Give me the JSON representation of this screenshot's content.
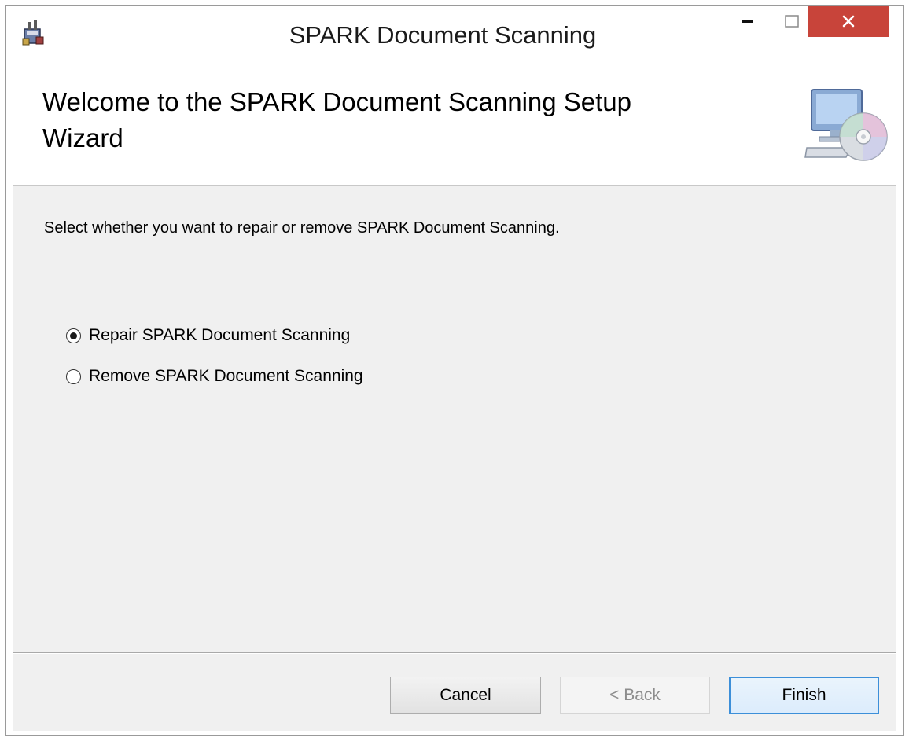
{
  "window": {
    "title": "SPARK Document Scanning"
  },
  "controls": {
    "minimize_icon": "minimize-icon",
    "maximize_icon": "maximize-icon",
    "close_icon": "close-icon",
    "close_color": "#c8443a"
  },
  "banner": {
    "title": "Welcome to the SPARK Document Scanning Setup Wizard",
    "icon": "computer-cd-icon"
  },
  "body": {
    "instruction": "Select whether you want to repair or remove SPARK Document Scanning.",
    "options": [
      {
        "label": "Repair SPARK Document Scanning",
        "selected": true
      },
      {
        "label": "Remove SPARK Document Scanning",
        "selected": false
      }
    ]
  },
  "footer": {
    "cancel_label": "Cancel",
    "back_label": "< Back",
    "back_enabled": false,
    "finish_label": "Finish",
    "default_button_color": "#3c8fd9"
  }
}
